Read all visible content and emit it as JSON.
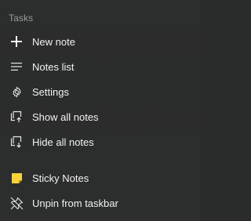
{
  "jumplist": {
    "section_title": "Tasks",
    "tasks": [
      {
        "label": "New note",
        "icon": "plus-icon"
      },
      {
        "label": "Notes list",
        "icon": "list-icon"
      },
      {
        "label": "Settings",
        "icon": "gear-icon"
      },
      {
        "label": "Show all notes",
        "icon": "show-windows-icon"
      },
      {
        "label": "Hide all notes",
        "icon": "hide-windows-icon"
      }
    ],
    "app": {
      "label": "Sticky Notes",
      "icon": "sticky-notes-app-icon",
      "accent": "#f9d23c"
    },
    "unpin": {
      "label": "Unpin from taskbar",
      "icon": "unpin-icon"
    }
  },
  "colors": {
    "background": "#2b2c2c",
    "text": "#f2f2f2",
    "section_title": "#9a9a9a",
    "sticky_yellow": "#f9d23c"
  }
}
